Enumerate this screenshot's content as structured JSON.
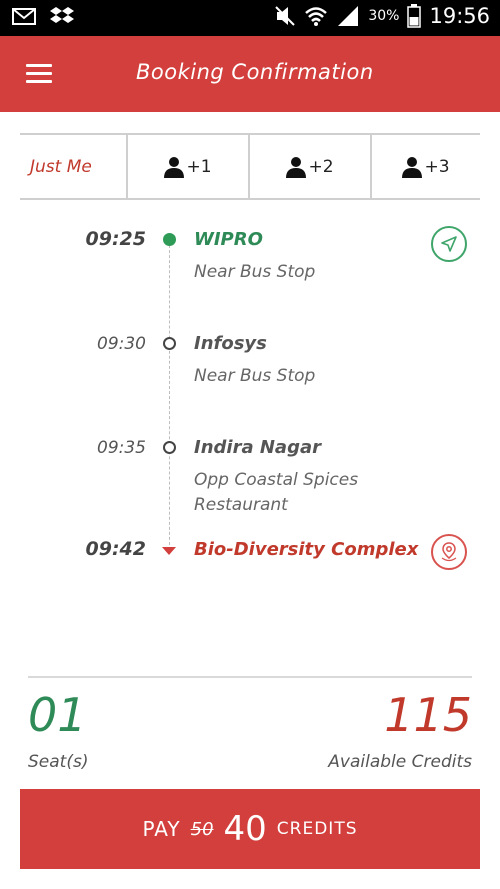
{
  "status_bar": {
    "battery": "30%",
    "time": "19:56"
  },
  "app_bar": {
    "title": "Booking Confirmation",
    "menu_icon": "hamburger-menu-icon"
  },
  "tabs": [
    {
      "label": "Just Me",
      "icon": ""
    },
    {
      "label": "+1",
      "icon": "person-icon"
    },
    {
      "label": "+2",
      "icon": "person-icon"
    },
    {
      "label": "+3",
      "icon": "person-icon"
    }
  ],
  "stops": [
    {
      "time": "09:25",
      "name": "WIPRO",
      "sub": "Near Bus Stop",
      "state": "start"
    },
    {
      "time": "09:30",
      "name": "Infosys",
      "sub": "Near Bus Stop",
      "state": "middle"
    },
    {
      "time": "09:35",
      "name": "Indira Nagar",
      "sub": "Opp Coastal Spices Restaurant",
      "state": "middle"
    },
    {
      "time": "09:42",
      "name": "Bio-Diversity Complex",
      "sub": "",
      "state": "end"
    }
  ],
  "summary": {
    "seats_value": "01",
    "seats_label": "Seat(s)",
    "credits_value": "115",
    "credits_label": "Available Credits"
  },
  "pay": {
    "label": "PAY",
    "old_price": "50",
    "new_price": "40",
    "unit": "CREDITS"
  },
  "colors": {
    "primary": "#d23f3c",
    "green": "#2e8b57"
  }
}
